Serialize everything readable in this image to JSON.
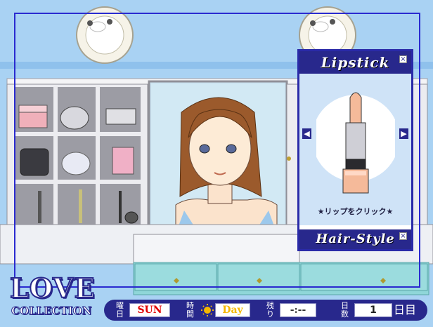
{
  "game": {
    "logo": {
      "line1": "LOVE",
      "line2": "COLLECTION"
    },
    "lipstick_panel": {
      "title": "Lipstick",
      "hint": "★リップをクリック★",
      "footer_title": "Hair-Style",
      "prev_glyph": "◀",
      "next_glyph": "▶",
      "close_glyph": "×"
    },
    "status_bar": {
      "weekday_label": "曜日",
      "weekday_value": "SUN",
      "time_label": "時間",
      "time_value": "Day",
      "remaining_label": "残り",
      "remaining_value": "-:--",
      "days_label": "日数",
      "days_value": "1",
      "days_unit": "日目"
    },
    "icons": [
      "sun-icon",
      "close-icon",
      "chevron-left-icon",
      "chevron-right-icon"
    ],
    "colors": {
      "wall": "#a9d2f3",
      "navy": "#28288c",
      "weekday_red": "#e00000",
      "time_yellow": "#f5b800",
      "lipstick_peach": "#f5ba9a"
    }
  }
}
